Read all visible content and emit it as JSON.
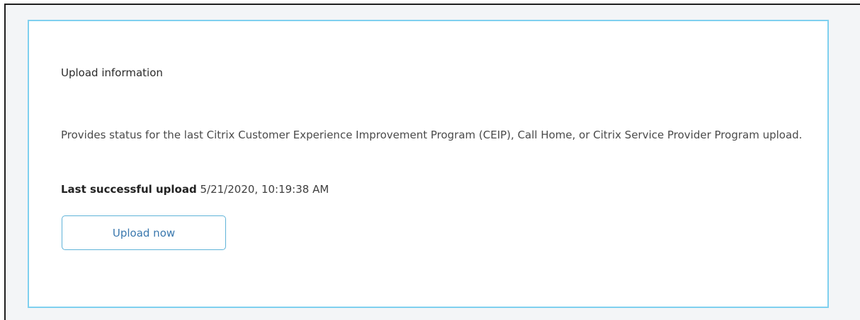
{
  "upload_info": {
    "title": "Upload information",
    "description": "Provides status for the last Citrix Customer Experience Improvement Program (CEIP), Call Home, or Citrix Service Provider Program upload.",
    "last_upload_label": "Last successful upload",
    "last_upload_value": "5/21/2020, 10:19:38 AM",
    "upload_button_label": "Upload now"
  },
  "colors": {
    "card_border": "#7fd0ef",
    "button_border": "#5fb3d8",
    "button_text": "#3a78ae",
    "page_background": "#f3f5f7"
  }
}
